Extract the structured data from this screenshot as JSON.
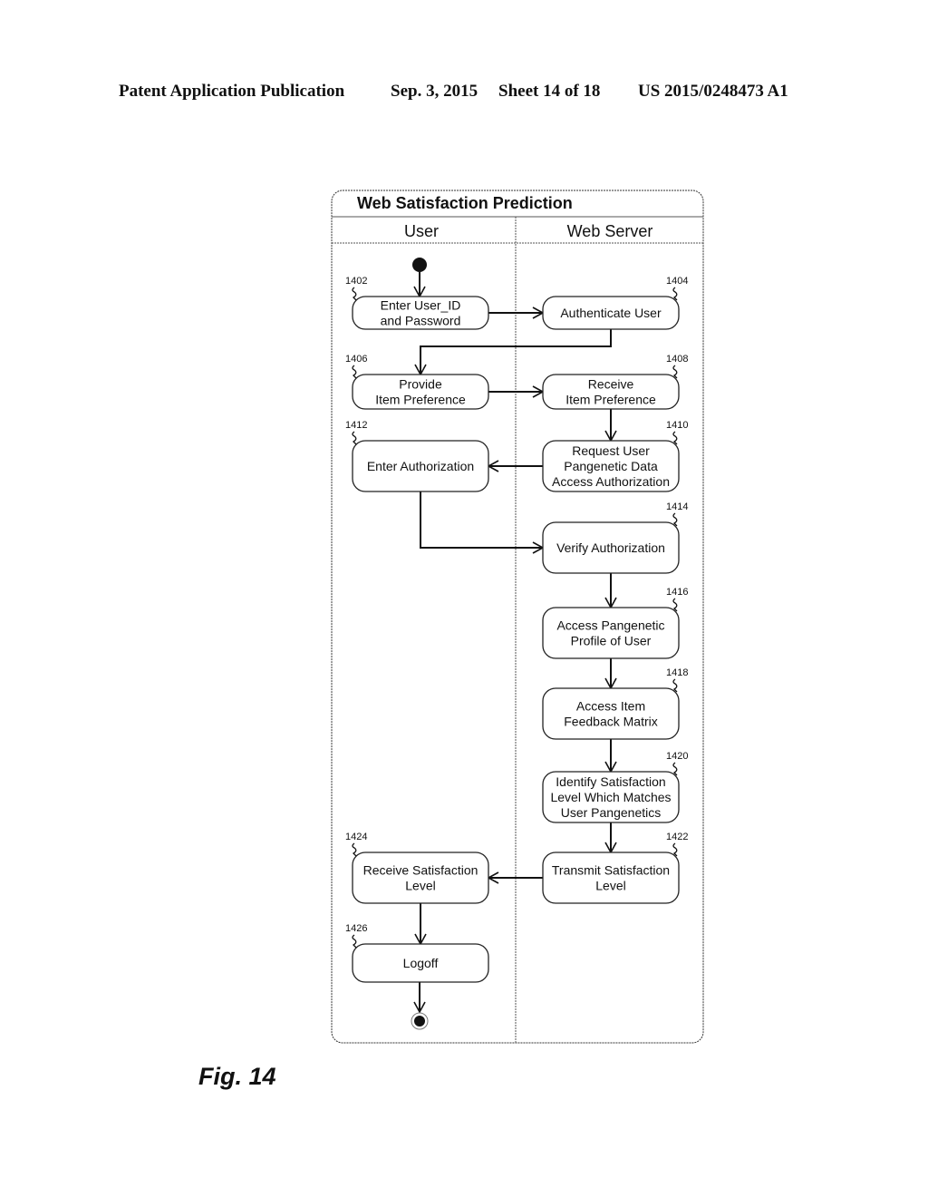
{
  "header": {
    "left": "Patent Application Publication",
    "date": "Sep. 3, 2015",
    "sheet": "Sheet 14 of 18",
    "number": "US 2015/0248473 A1"
  },
  "diagram": {
    "title": "Web Satisfaction Prediction",
    "lanes": [
      "User",
      "Web Server"
    ],
    "nodes": [
      {
        "id": "1402",
        "lane": "User",
        "lines": [
          "Enter User_ID",
          "and Password"
        ]
      },
      {
        "id": "1404",
        "lane": "Web Server",
        "lines": [
          "Authenticate User"
        ]
      },
      {
        "id": "1406",
        "lane": "User",
        "lines": [
          "Provide",
          "Item Preference"
        ]
      },
      {
        "id": "1408",
        "lane": "Web Server",
        "lines": [
          "Receive",
          "Item Preference"
        ]
      },
      {
        "id": "1410",
        "lane": "Web Server",
        "lines": [
          "Request User",
          "Pangenetic Data",
          "Access Authorization"
        ]
      },
      {
        "id": "1412",
        "lane": "User",
        "lines": [
          "Enter Authorization"
        ]
      },
      {
        "id": "1414",
        "lane": "Web Server",
        "lines": [
          "Verify Authorization"
        ]
      },
      {
        "id": "1416",
        "lane": "Web Server",
        "lines": [
          "Access Pangenetic",
          "Profile of User"
        ]
      },
      {
        "id": "1418",
        "lane": "Web Server",
        "lines": [
          "Access Item",
          "Feedback Matrix"
        ]
      },
      {
        "id": "1420",
        "lane": "Web Server",
        "lines": [
          "Identify Satisfaction",
          "Level Which Matches",
          "User Pangenetics"
        ]
      },
      {
        "id": "1422",
        "lane": "Web Server",
        "lines": [
          "Transmit Satisfaction",
          "Level"
        ]
      },
      {
        "id": "1424",
        "lane": "User",
        "lines": [
          "Receive Satisfaction",
          "Level"
        ]
      },
      {
        "id": "1426",
        "lane": "User",
        "lines": [
          "Logoff"
        ]
      }
    ],
    "edges": [
      [
        "start",
        "1402"
      ],
      [
        "1402",
        "1404"
      ],
      [
        "1404",
        "1406"
      ],
      [
        "1406",
        "1408"
      ],
      [
        "1408",
        "1410"
      ],
      [
        "1410",
        "1412"
      ],
      [
        "1412",
        "1414"
      ],
      [
        "1414",
        "1416"
      ],
      [
        "1416",
        "1418"
      ],
      [
        "1418",
        "1420"
      ],
      [
        "1420",
        "1422"
      ],
      [
        "1422",
        "1424"
      ],
      [
        "1424",
        "1426"
      ],
      [
        "1426",
        "end"
      ]
    ]
  },
  "figure_label": "Fig. 14"
}
